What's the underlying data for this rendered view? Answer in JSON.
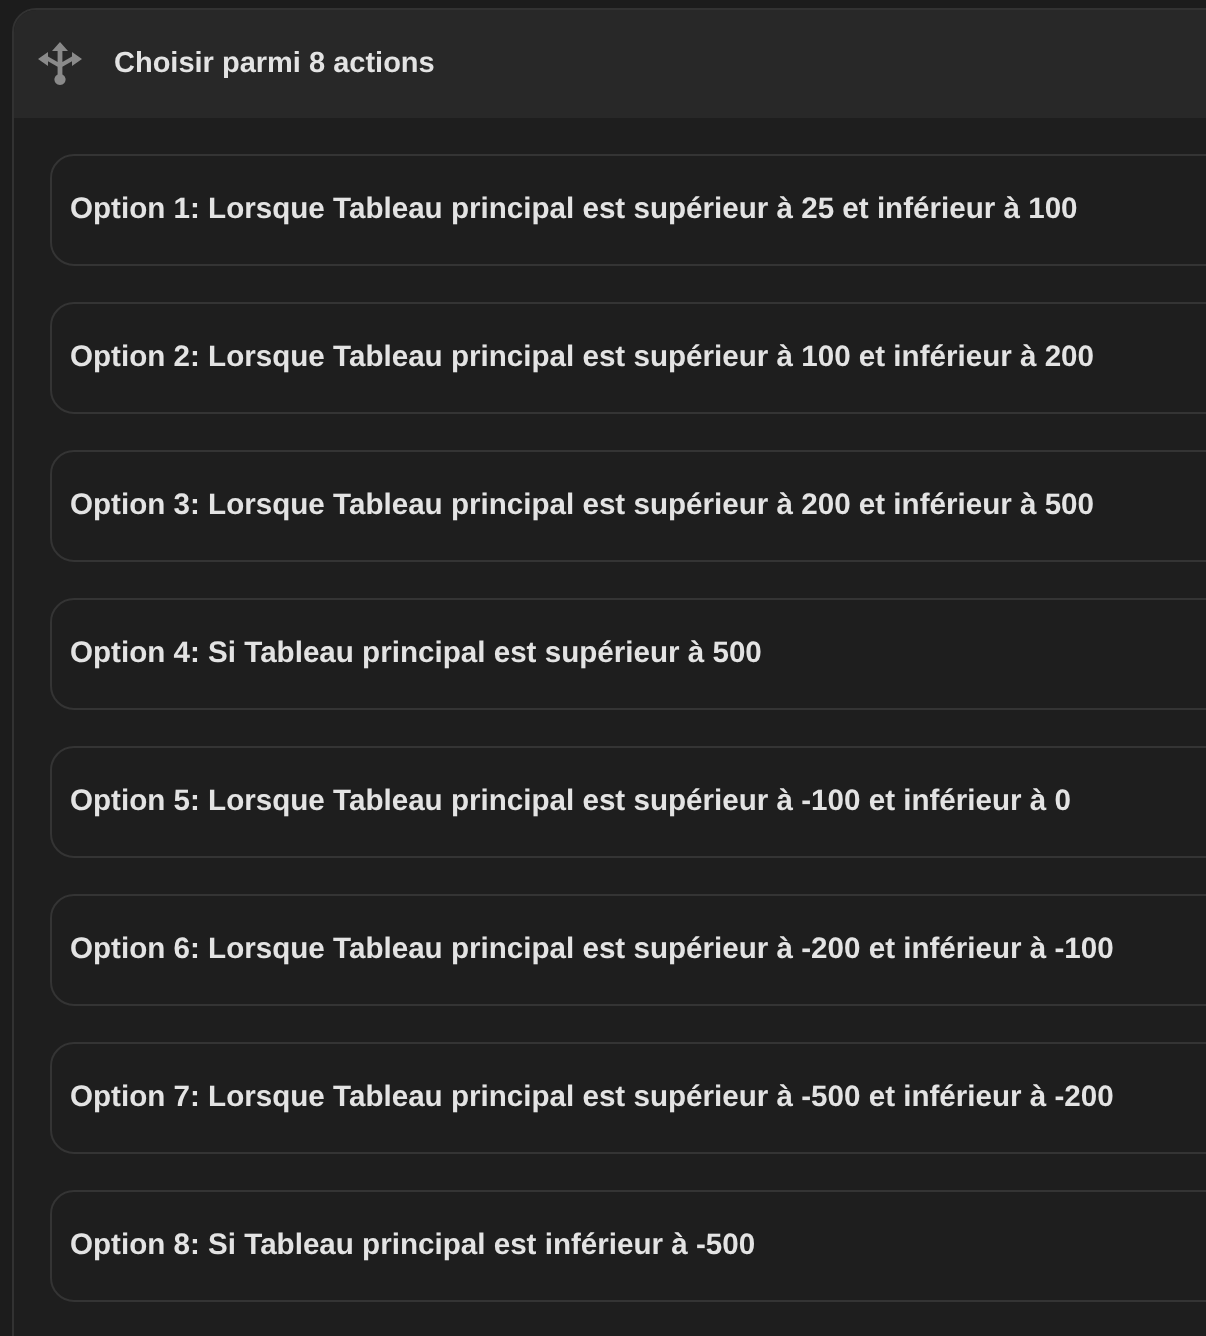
{
  "header": {
    "title": "Choisir parmi 8 actions"
  },
  "options": [
    {
      "label": "Option 1: Lorsque Tableau principal est supérieur à 25 et inférieur à 100"
    },
    {
      "label": "Option 2: Lorsque Tableau principal est supérieur à 100 et inférieur à 200"
    },
    {
      "label": "Option 3: Lorsque Tableau principal est supérieur à 200 et inférieur à 500"
    },
    {
      "label": "Option 4: Si Tableau principal est supérieur à 500"
    },
    {
      "label": "Option 5: Lorsque Tableau principal est supérieur à -100 et inférieur à 0"
    },
    {
      "label": "Option 6: Lorsque Tableau principal est supérieur à -200 et inférieur à -100"
    },
    {
      "label": "Option 7: Lorsque Tableau principal est supérieur à -500 et inférieur à -200"
    },
    {
      "label": "Option 8: Si Tableau principal est inférieur à -500"
    }
  ]
}
